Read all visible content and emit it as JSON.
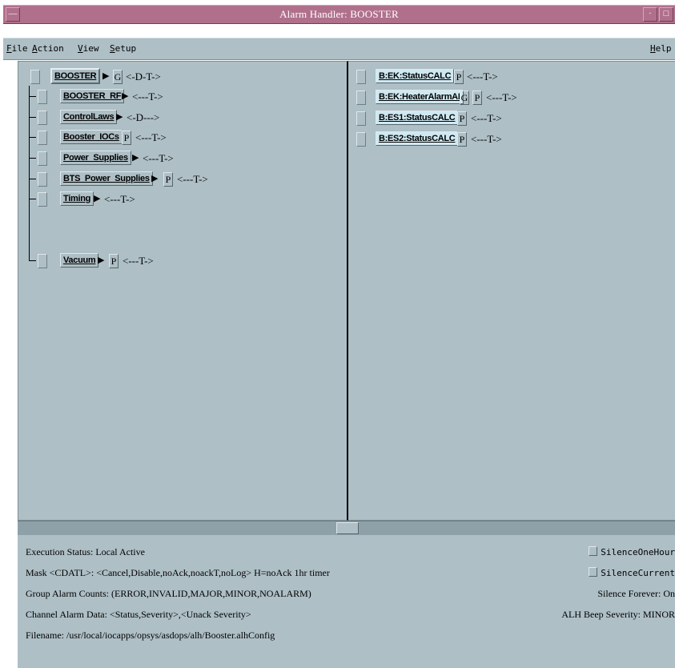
{
  "window": {
    "title": "Alarm Handler: BOOSTER",
    "menu_glyph": "—",
    "min_glyph": "·",
    "max_glyph": "□"
  },
  "menubar": {
    "file": {
      "u": "F",
      "rest": "ile"
    },
    "action": {
      "u": "A",
      "rest": "ction"
    },
    "view": {
      "u": "V",
      "rest": "iew"
    },
    "setup": {
      "u": "S",
      "rest": "etup"
    },
    "help": {
      "u": "H",
      "rest": "elp"
    }
  },
  "groups": [
    {
      "name": "BOOSTER",
      "arrow": "▶",
      "flag": "G",
      "mask": "<-D-T->"
    },
    {
      "name": "BOOSTER_RF",
      "arrow": "▶",
      "flag": "",
      "mask": "<---T->"
    },
    {
      "name": "ControlLaws",
      "arrow": "▶",
      "flag": "",
      "mask": "<-D--->"
    },
    {
      "name": "Booster_IOCs",
      "arrow": "",
      "flag": "P",
      "mask": "<---T->"
    },
    {
      "name": "Power_Supplies",
      "arrow": "▶",
      "flag": "",
      "mask": "<---T->"
    },
    {
      "name": "BTS_Power_Supplies",
      "arrow": "▶",
      "flag": "P",
      "mask": "<---T->"
    },
    {
      "name": "Timing",
      "arrow": "▶",
      "flag": "",
      "mask": "<---T->"
    },
    {
      "name": "Vacuum",
      "arrow": "▶",
      "flag": "P",
      "mask": "<---T->"
    }
  ],
  "channels": [
    {
      "name": "B:EK:StatusCALC",
      "flag1": "P",
      "flag2": "",
      "mask": "<---T->"
    },
    {
      "name": "B:EK:HeaterAlarmAI",
      "flag1": "G",
      "flag2": "P",
      "mask": "<---T->"
    },
    {
      "name": "B:ES1:StatusCALC",
      "flag1": "P",
      "flag2": "",
      "mask": "<---T->"
    },
    {
      "name": "B:ES2:StatusCALC",
      "flag1": "P",
      "flag2": "",
      "mask": "<---T->"
    }
  ],
  "status": {
    "execution": "Execution Status:  Local Active",
    "mask": "Mask <CDATL>:  <Cancel,Disable,noAck,noackT,noLog>     H=noAck 1hr timer",
    "group_counts": "Group Alarm Counts:  (ERROR,INVALID,MAJOR,MINOR,NOALARM)",
    "channel_data": "Channel Alarm Data:  <Status,Severity>,<Unack Severity>",
    "filename": "Filename:   /usr/local/iocapps/opsys/asdops/alh/Booster.alhConfig",
    "silence_one_hour": "SilenceOneHour",
    "silence_current": "SilenceCurrent",
    "silence_forever": "Silence Forever:  On",
    "beep_severity": "ALH Beep Severity:  MINOR"
  }
}
